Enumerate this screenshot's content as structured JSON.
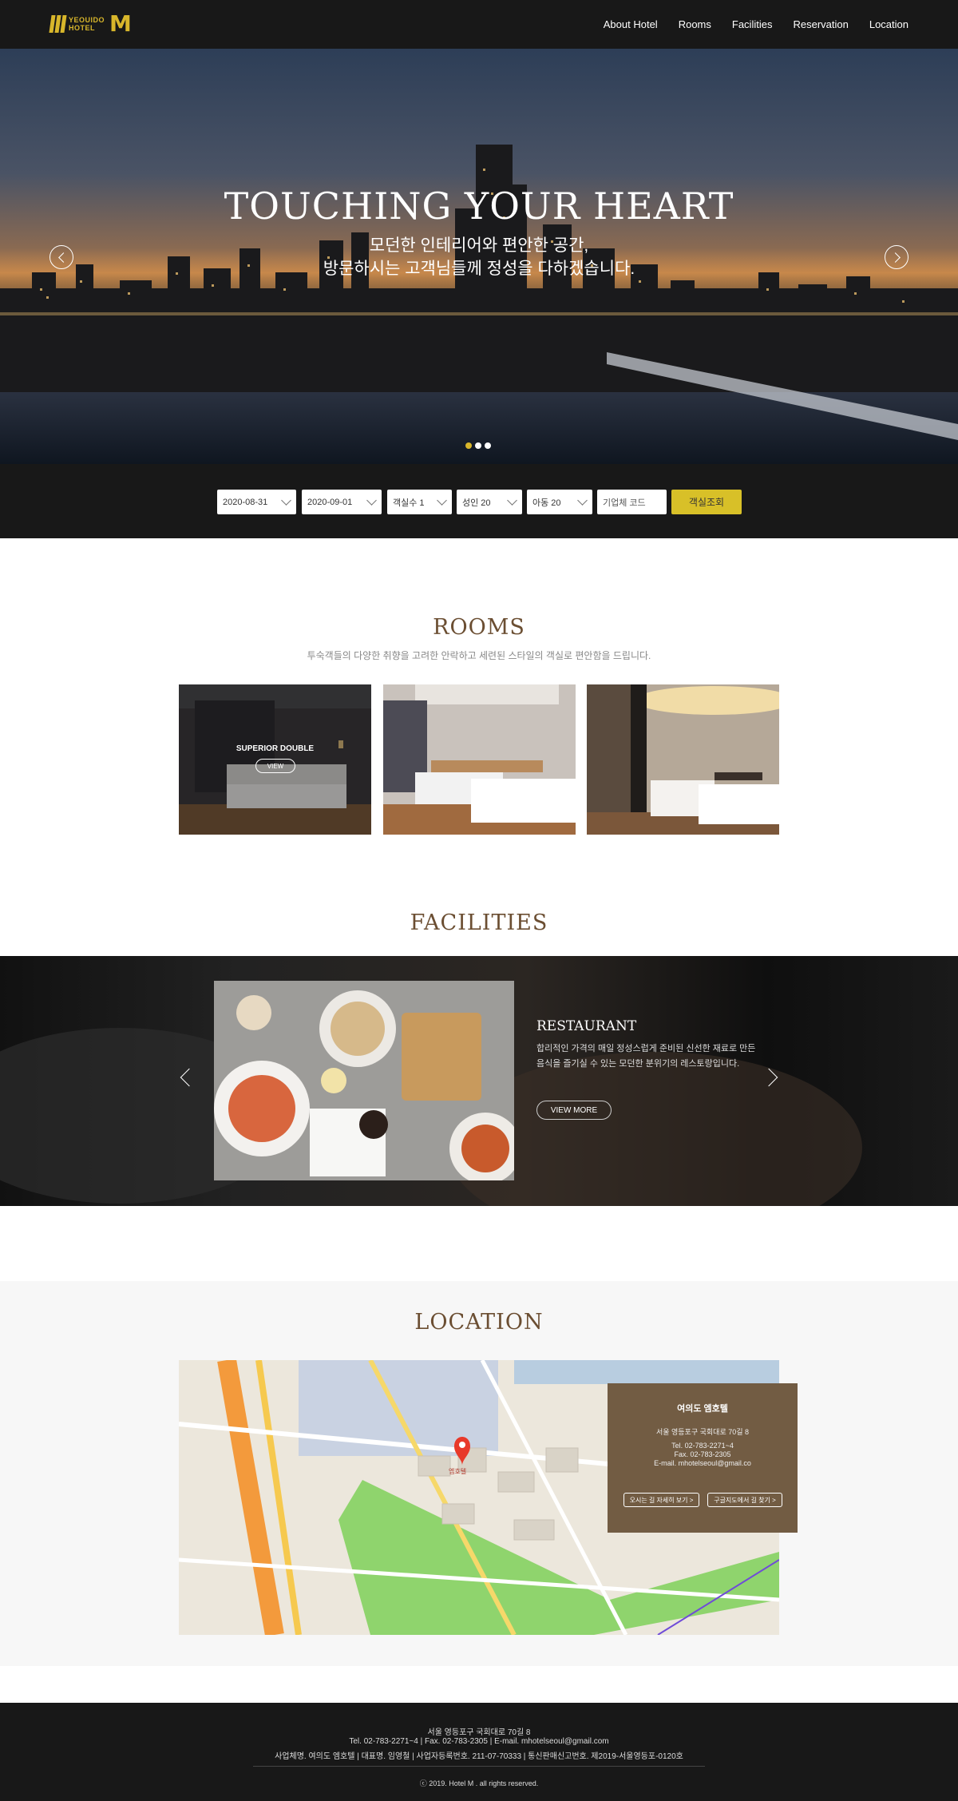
{
  "header": {
    "logo": {
      "line1": "YEOUIDO",
      "line2": "HOTEL",
      "mark": "M"
    },
    "nav": [
      "About Hotel",
      "Rooms",
      "Facilities",
      "Reservation",
      "Location"
    ]
  },
  "hero": {
    "title": "TOUCHING YOUR HEART",
    "subtitle_line1": "모던한 인테리어와 편안한 공간,",
    "subtitle_line2": "방문하시는 고객님들께 정성을 다하겠습니다.",
    "slide_count": 3,
    "active_slide": 1,
    "prev_icon": "chevron-left-icon",
    "next_icon": "chevron-right-icon"
  },
  "booking": {
    "checkin": "2020-08-31",
    "checkout": "2020-09-01",
    "rooms": "객실수 1",
    "adults": "성인 20",
    "children": "아동 20",
    "corporate_placeholder": "기업체 코드",
    "search_label": "객실조회"
  },
  "rooms": {
    "title": "ROOMS",
    "description": "투숙객들의 다양한 취향을 고려한 안락하고 세련된 스타일의 객실로 편안함을 드립니다.",
    "items": [
      {
        "label": "SUPERIOR DOUBLE",
        "view_label": "VIEW"
      }
    ]
  },
  "facilities": {
    "title": "FACILITIES",
    "name": "RESTAURANT",
    "desc_line1": "합리적인 가격의 매일 정성스럽게 준비된 신선한 재료로 만든",
    "desc_line2": "음식을 즐기실 수 있는 모던한 분위기의 레스토랑입니다.",
    "button_label": "VIEW MORE"
  },
  "location": {
    "title": "LOCATION",
    "card": {
      "name": "여의도 엠호텔",
      "address": "서울 영등포구 국회대로 70길 8",
      "tel": "Tel. 02-783-2271~4",
      "fax": "Fax. 02-783-2305",
      "email": "E-mail. mhotelseoul@gmail.co",
      "button_directions": "오시는 길 자세히 보기 >",
      "button_google": "구글지도에서 길 찾기 >"
    },
    "map_pin_label": "엠호텔"
  },
  "footer": {
    "address": "서울 영등포구 국회대로 70길 8",
    "contact": "Tel. 02-783-2271~4   |   Fax. 02-783-2305   |   E-mail. mhotelseoul@gmail.com",
    "business": "사업체명. 여의도 엠호텔   |   대표명. 임영철   |   사업자등록번호. 211-07-70333   |   통신판매신고번호. 제2019-서울영등포-0120호",
    "copyright": "ⓒ 2019. Hotel M . all rights reserved."
  },
  "colors": {
    "gold": "#d8b62b",
    "brown": "#6b4e32",
    "card": "#725c43",
    "dark": "#181818"
  }
}
